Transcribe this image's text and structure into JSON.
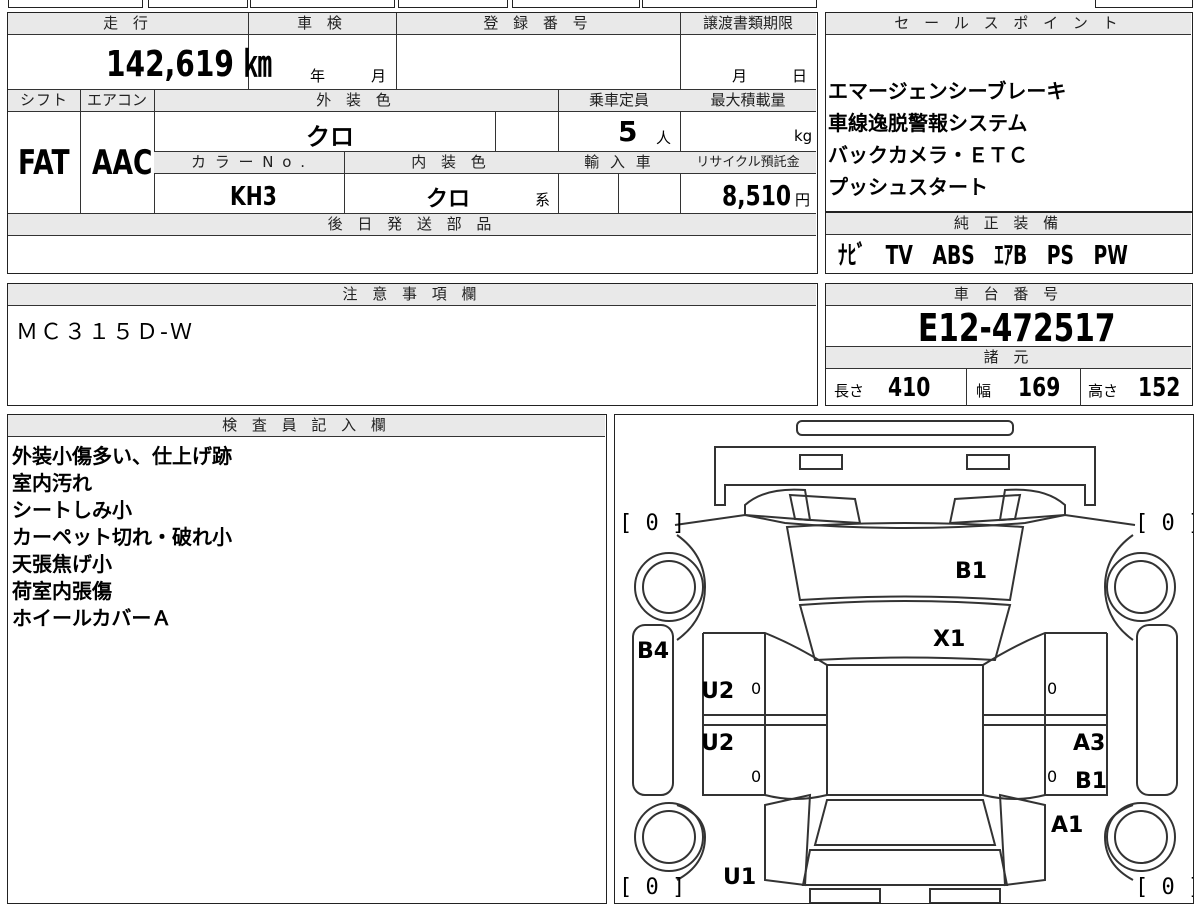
{
  "vehicle": {
    "mileage_label": "走 行",
    "mileage": "142,619 ㎞",
    "inspection_label": "車 検",
    "year_unit": "年",
    "month_unit": "月",
    "registration_label": "登 録 番 号",
    "transfer_deadline_label": "譲渡書類期限",
    "transfer_month_unit": "月",
    "transfer_day_unit": "日",
    "shift_label": "シフト",
    "shift": "FAT",
    "ac_label": "エアコン",
    "ac": "AAC",
    "exterior_color_label": "外 装 色",
    "exterior_color": "クロ",
    "capacity_label": "乗車定員",
    "capacity": "5",
    "capacity_unit": "人",
    "max_load_label": "最大積載量",
    "max_load_unit": "kg",
    "color_no_label": "カ ラ ー N o .",
    "color_no": "KH3",
    "interior_color_label": "内 装 色",
    "interior_color": "クロ",
    "interior_color_suffix": "系",
    "import_label": "輸 入 車",
    "recycle_label": "リサイクル預託金",
    "recycle_fee": "8,510",
    "recycle_unit": "円",
    "later_parts_label": "後 日 発 送 部 品"
  },
  "sales_points": {
    "label": "セ ー ル ス ポ イ ン ト",
    "items": [
      "エマージェンシーブレーキ",
      "車線逸脱警報システム",
      "バックカメラ・ＥＴＣ",
      "プッシュスタート"
    ]
  },
  "genuine_equipment": {
    "label": "純 正 装 備",
    "items": [
      "ﾅﾋﾞ",
      "TV",
      "ABS",
      "ｴｱB",
      "PS",
      "PW"
    ]
  },
  "caution": {
    "label": "注 意 事 項 欄",
    "text": "ＭＣ３１５Ｄ-Ｗ"
  },
  "chassis": {
    "label": "車 台 番 号",
    "number": "E12-472517",
    "specs_label": "諸 元",
    "length_label": "長さ",
    "length": "410",
    "width_label": "幅",
    "width": "169",
    "height_label": "高さ",
    "height": "152"
  },
  "inspector": {
    "label": "検 査 員 記 入 欄",
    "notes": [
      "外装小傷多い、仕上げ跡",
      "室内汚れ",
      "シートしみ小",
      "カーペット切れ・破れ小",
      "天張焦げ小",
      "荷室内張傷",
      "ホイールカバーＡ"
    ]
  },
  "diagram": {
    "tire_fl": "[ 0 ]",
    "tire_fr": "[ 0 ]",
    "tire_rl": "[ 0 ]",
    "tire_rr": "[ 0 ]",
    "marks": {
      "hood": "B1",
      "windshield": "X1",
      "left_fender": "B4",
      "left_front_door": "U2",
      "left_rear_door": "U2",
      "left_rear_quarter": "U1",
      "right_rear_door_1": "A3",
      "right_rear_door_2": "B1",
      "right_rear_quarter": "A1",
      "door_zero_1": "0",
      "door_zero_2": "0",
      "door_zero_3": "0",
      "door_zero_4": "0"
    }
  }
}
